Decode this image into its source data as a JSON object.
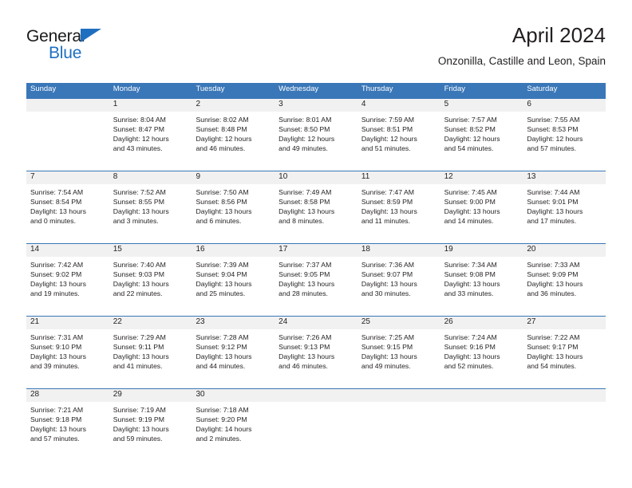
{
  "brand": {
    "logo_word_1": "General",
    "logo_word_2": "Blue",
    "logo_triangle_icon": "triangle-icon",
    "accent_color": "#1f6fc0"
  },
  "header": {
    "title": "April 2024",
    "subtitle": "Onzonilla, Castille and Leon, Spain"
  },
  "theme": {
    "header_bar_color": "#3a77b8",
    "number_band_color": "#f1f1f1",
    "text_color": "#231f20"
  },
  "weekdays": [
    "Sunday",
    "Monday",
    "Tuesday",
    "Wednesday",
    "Thursday",
    "Friday",
    "Saturday"
  ],
  "weeks": [
    {
      "days": [
        {
          "number": "",
          "sunrise": "",
          "sunset": "",
          "daylight_1": "",
          "daylight_2": "",
          "empty": true
        },
        {
          "number": "1",
          "sunrise": "Sunrise: 8:04 AM",
          "sunset": "Sunset: 8:47 PM",
          "daylight_1": "Daylight: 12 hours",
          "daylight_2": "and 43 minutes."
        },
        {
          "number": "2",
          "sunrise": "Sunrise: 8:02 AM",
          "sunset": "Sunset: 8:48 PM",
          "daylight_1": "Daylight: 12 hours",
          "daylight_2": "and 46 minutes."
        },
        {
          "number": "3",
          "sunrise": "Sunrise: 8:01 AM",
          "sunset": "Sunset: 8:50 PM",
          "daylight_1": "Daylight: 12 hours",
          "daylight_2": "and 49 minutes."
        },
        {
          "number": "4",
          "sunrise": "Sunrise: 7:59 AM",
          "sunset": "Sunset: 8:51 PM",
          "daylight_1": "Daylight: 12 hours",
          "daylight_2": "and 51 minutes."
        },
        {
          "number": "5",
          "sunrise": "Sunrise: 7:57 AM",
          "sunset": "Sunset: 8:52 PM",
          "daylight_1": "Daylight: 12 hours",
          "daylight_2": "and 54 minutes."
        },
        {
          "number": "6",
          "sunrise": "Sunrise: 7:55 AM",
          "sunset": "Sunset: 8:53 PM",
          "daylight_1": "Daylight: 12 hours",
          "daylight_2": "and 57 minutes."
        }
      ]
    },
    {
      "days": [
        {
          "number": "7",
          "sunrise": "Sunrise: 7:54 AM",
          "sunset": "Sunset: 8:54 PM",
          "daylight_1": "Daylight: 13 hours",
          "daylight_2": "and 0 minutes."
        },
        {
          "number": "8",
          "sunrise": "Sunrise: 7:52 AM",
          "sunset": "Sunset: 8:55 PM",
          "daylight_1": "Daylight: 13 hours",
          "daylight_2": "and 3 minutes."
        },
        {
          "number": "9",
          "sunrise": "Sunrise: 7:50 AM",
          "sunset": "Sunset: 8:56 PM",
          "daylight_1": "Daylight: 13 hours",
          "daylight_2": "and 6 minutes."
        },
        {
          "number": "10",
          "sunrise": "Sunrise: 7:49 AM",
          "sunset": "Sunset: 8:58 PM",
          "daylight_1": "Daylight: 13 hours",
          "daylight_2": "and 8 minutes."
        },
        {
          "number": "11",
          "sunrise": "Sunrise: 7:47 AM",
          "sunset": "Sunset: 8:59 PM",
          "daylight_1": "Daylight: 13 hours",
          "daylight_2": "and 11 minutes."
        },
        {
          "number": "12",
          "sunrise": "Sunrise: 7:45 AM",
          "sunset": "Sunset: 9:00 PM",
          "daylight_1": "Daylight: 13 hours",
          "daylight_2": "and 14 minutes."
        },
        {
          "number": "13",
          "sunrise": "Sunrise: 7:44 AM",
          "sunset": "Sunset: 9:01 PM",
          "daylight_1": "Daylight: 13 hours",
          "daylight_2": "and 17 minutes."
        }
      ]
    },
    {
      "days": [
        {
          "number": "14",
          "sunrise": "Sunrise: 7:42 AM",
          "sunset": "Sunset: 9:02 PM",
          "daylight_1": "Daylight: 13 hours",
          "daylight_2": "and 19 minutes."
        },
        {
          "number": "15",
          "sunrise": "Sunrise: 7:40 AM",
          "sunset": "Sunset: 9:03 PM",
          "daylight_1": "Daylight: 13 hours",
          "daylight_2": "and 22 minutes."
        },
        {
          "number": "16",
          "sunrise": "Sunrise: 7:39 AM",
          "sunset": "Sunset: 9:04 PM",
          "daylight_1": "Daylight: 13 hours",
          "daylight_2": "and 25 minutes."
        },
        {
          "number": "17",
          "sunrise": "Sunrise: 7:37 AM",
          "sunset": "Sunset: 9:05 PM",
          "daylight_1": "Daylight: 13 hours",
          "daylight_2": "and 28 minutes."
        },
        {
          "number": "18",
          "sunrise": "Sunrise: 7:36 AM",
          "sunset": "Sunset: 9:07 PM",
          "daylight_1": "Daylight: 13 hours",
          "daylight_2": "and 30 minutes."
        },
        {
          "number": "19",
          "sunrise": "Sunrise: 7:34 AM",
          "sunset": "Sunset: 9:08 PM",
          "daylight_1": "Daylight: 13 hours",
          "daylight_2": "and 33 minutes."
        },
        {
          "number": "20",
          "sunrise": "Sunrise: 7:33 AM",
          "sunset": "Sunset: 9:09 PM",
          "daylight_1": "Daylight: 13 hours",
          "daylight_2": "and 36 minutes."
        }
      ]
    },
    {
      "days": [
        {
          "number": "21",
          "sunrise": "Sunrise: 7:31 AM",
          "sunset": "Sunset: 9:10 PM",
          "daylight_1": "Daylight: 13 hours",
          "daylight_2": "and 39 minutes."
        },
        {
          "number": "22",
          "sunrise": "Sunrise: 7:29 AM",
          "sunset": "Sunset: 9:11 PM",
          "daylight_1": "Daylight: 13 hours",
          "daylight_2": "and 41 minutes."
        },
        {
          "number": "23",
          "sunrise": "Sunrise: 7:28 AM",
          "sunset": "Sunset: 9:12 PM",
          "daylight_1": "Daylight: 13 hours",
          "daylight_2": "and 44 minutes."
        },
        {
          "number": "24",
          "sunrise": "Sunrise: 7:26 AM",
          "sunset": "Sunset: 9:13 PM",
          "daylight_1": "Daylight: 13 hours",
          "daylight_2": "and 46 minutes."
        },
        {
          "number": "25",
          "sunrise": "Sunrise: 7:25 AM",
          "sunset": "Sunset: 9:15 PM",
          "daylight_1": "Daylight: 13 hours",
          "daylight_2": "and 49 minutes."
        },
        {
          "number": "26",
          "sunrise": "Sunrise: 7:24 AM",
          "sunset": "Sunset: 9:16 PM",
          "daylight_1": "Daylight: 13 hours",
          "daylight_2": "and 52 minutes."
        },
        {
          "number": "27",
          "sunrise": "Sunrise: 7:22 AM",
          "sunset": "Sunset: 9:17 PM",
          "daylight_1": "Daylight: 13 hours",
          "daylight_2": "and 54 minutes."
        }
      ]
    },
    {
      "days": [
        {
          "number": "28",
          "sunrise": "Sunrise: 7:21 AM",
          "sunset": "Sunset: 9:18 PM",
          "daylight_1": "Daylight: 13 hours",
          "daylight_2": "and 57 minutes."
        },
        {
          "number": "29",
          "sunrise": "Sunrise: 7:19 AM",
          "sunset": "Sunset: 9:19 PM",
          "daylight_1": "Daylight: 13 hours",
          "daylight_2": "and 59 minutes."
        },
        {
          "number": "30",
          "sunrise": "Sunrise: 7:18 AM",
          "sunset": "Sunset: 9:20 PM",
          "daylight_1": "Daylight: 14 hours",
          "daylight_2": "and 2 minutes."
        },
        {
          "number": "",
          "sunrise": "",
          "sunset": "",
          "daylight_1": "",
          "daylight_2": "",
          "empty": true
        },
        {
          "number": "",
          "sunrise": "",
          "sunset": "",
          "daylight_1": "",
          "daylight_2": "",
          "empty": true
        },
        {
          "number": "",
          "sunrise": "",
          "sunset": "",
          "daylight_1": "",
          "daylight_2": "",
          "empty": true
        },
        {
          "number": "",
          "sunrise": "",
          "sunset": "",
          "daylight_1": "",
          "daylight_2": "",
          "empty": true
        }
      ]
    }
  ]
}
